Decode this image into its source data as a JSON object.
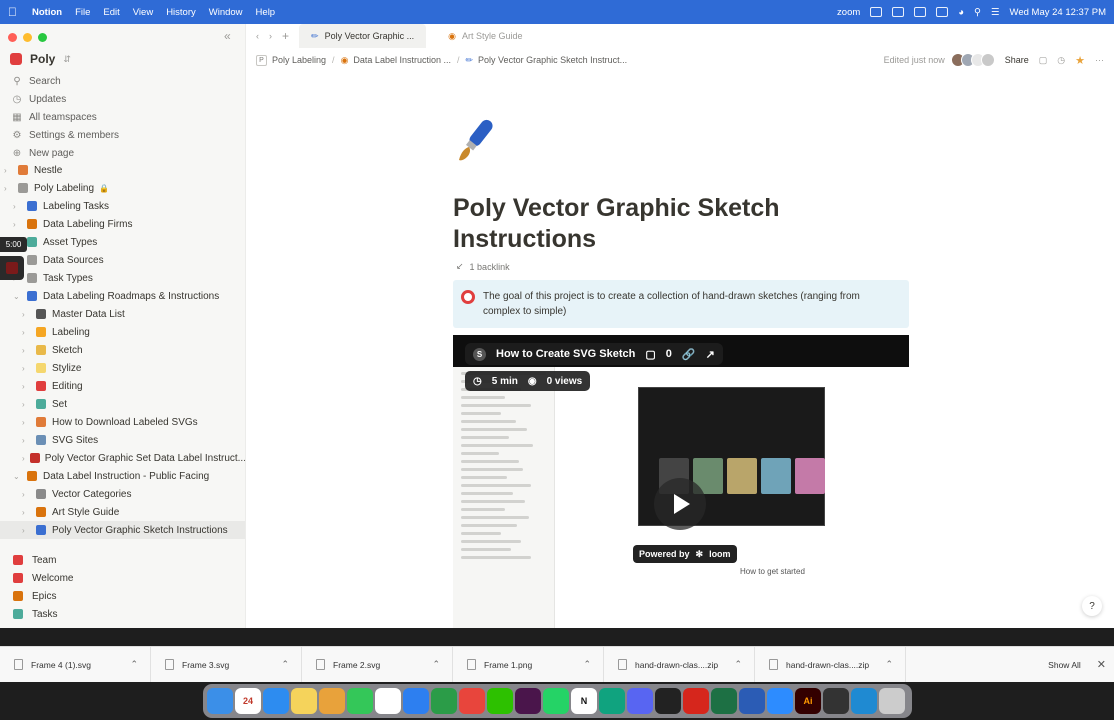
{
  "menubar": {
    "app": "Notion",
    "menus": [
      "File",
      "Edit",
      "View",
      "History",
      "Window",
      "Help"
    ],
    "zoom": "zoom",
    "datetime": "Wed May 24  12:37 PM"
  },
  "sidebar": {
    "workspace": "Poly",
    "nav": [
      {
        "label": "Search",
        "icon": "search-icon"
      },
      {
        "label": "Updates",
        "icon": "clock-icon"
      },
      {
        "label": "All teamspaces",
        "icon": "grid-icon"
      },
      {
        "label": "Settings & members",
        "icon": "gear-icon"
      },
      {
        "label": "New page",
        "icon": "plus-icon"
      }
    ],
    "tree": [
      {
        "label": "Nestle",
        "indent": 0,
        "color": "#e07b39"
      },
      {
        "label": "Poly Labeling",
        "indent": 0,
        "color": "#9b9a97",
        "lock": true
      },
      {
        "label": "Labeling Tasks",
        "indent": 1,
        "color": "#3b6fd1"
      },
      {
        "label": "Data Labeling Firms",
        "indent": 1,
        "color": "#d9730d"
      },
      {
        "label": "Asset Types",
        "indent": 1,
        "color": "#4dab9a"
      },
      {
        "label": "Data Sources",
        "indent": 1,
        "color": "#9b9a97"
      },
      {
        "label": "Task Types",
        "indent": 1,
        "color": "#9b9a97"
      },
      {
        "label": "Data Labeling Roadmaps & Instructions",
        "indent": 1,
        "color": "#3b6fd1",
        "open": true
      },
      {
        "label": "Master Data List",
        "indent": 2,
        "color": "#555"
      },
      {
        "label": "Labeling",
        "indent": 2,
        "color": "#f5a623"
      },
      {
        "label": "Sketch",
        "indent": 2,
        "color": "#e9b949"
      },
      {
        "label": "Stylize",
        "indent": 2,
        "color": "#f5d76e"
      },
      {
        "label": "Editing",
        "indent": 2,
        "color": "#e03e3e"
      },
      {
        "label": "Set",
        "indent": 2,
        "color": "#4dab9a"
      },
      {
        "label": "How to Download Labeled SVGs",
        "indent": 2,
        "color": "#e07b39"
      },
      {
        "label": "SVG Sites",
        "indent": 2,
        "color": "#6b8fb5"
      },
      {
        "label": "Poly Vector Graphic Set Data Label Instruct...",
        "indent": 2,
        "color": "#c4302b"
      },
      {
        "label": "Data Label Instruction - Public Facing",
        "indent": 1,
        "color": "#d9730d",
        "open": true
      },
      {
        "label": "Vector Categories",
        "indent": 2,
        "color": "#8a8a8a"
      },
      {
        "label": "Art Style Guide",
        "indent": 2,
        "color": "#d9730d"
      },
      {
        "label": "Poly Vector Graphic Sketch Instructions",
        "indent": 2,
        "color": "#3b6fd1",
        "active": true
      }
    ],
    "bottom": [
      {
        "label": "Team",
        "color": "#e03e3e"
      },
      {
        "label": "Welcome",
        "color": "#e03e3e"
      },
      {
        "label": "Epics",
        "color": "#d9730d"
      },
      {
        "label": "Tasks",
        "color": "#4dab9a"
      }
    ],
    "timer": "5:00"
  },
  "tabs": [
    {
      "label": "Poly Vector Graphic ...",
      "active": true
    },
    {
      "label": "Art Style Guide",
      "active": false
    }
  ],
  "breadcrumb": {
    "items": [
      "Poly Labeling",
      "Data Label Instruction ...",
      "Poly Vector Graphic Sketch Instruct..."
    ],
    "edited": "Edited just now",
    "share": "Share"
  },
  "page": {
    "title": "Poly Vector Graphic Sketch Instructions",
    "backlinks": "1 backlink",
    "callout": "The goal of this project is to create a collection of hand-drawn sketches (ranging from complex to simple)"
  },
  "video": {
    "title": "How to Create SVG Sketch",
    "comments": "0",
    "duration": "5 min",
    "views": "0 views",
    "powered": "Powered by",
    "brand": "loom",
    "inner_text": "How to get started"
  },
  "downloads": {
    "items": [
      "Frame 4 (1).svg",
      "Frame 3.svg",
      "Frame 2.svg",
      "Frame 1.png",
      "hand-drawn-clas....zip",
      "hand-drawn-clas....zip"
    ],
    "show_all": "Show All"
  },
  "dock": {
    "apps": [
      {
        "name": "finder",
        "color": "#3b8fe8"
      },
      {
        "name": "calendar",
        "color": "#ffffff",
        "text": "24"
      },
      {
        "name": "app-store",
        "color": "#2d8cf0"
      },
      {
        "name": "notes",
        "color": "#f5d35b"
      },
      {
        "name": "photos",
        "color": "#e8a23b"
      },
      {
        "name": "messages",
        "color": "#34c759"
      },
      {
        "name": "reminders",
        "color": "#ffffff"
      },
      {
        "name": "keynote",
        "color": "#2d7ff0"
      },
      {
        "name": "numbers",
        "color": "#2b9c48"
      },
      {
        "name": "chrome",
        "color": "#e8453c"
      },
      {
        "name": "wechat",
        "color": "#2dc100"
      },
      {
        "name": "slack",
        "color": "#4a154b"
      },
      {
        "name": "whatsapp",
        "color": "#25d366"
      },
      {
        "name": "notion",
        "color": "#ffffff",
        "text": "N"
      },
      {
        "name": "chatgpt",
        "color": "#10a37f"
      },
      {
        "name": "discord",
        "color": "#5865f2"
      },
      {
        "name": "terminal",
        "color": "#222222"
      },
      {
        "name": "acrobat",
        "color": "#d6261c"
      },
      {
        "name": "excel",
        "color": "#1d7044"
      },
      {
        "name": "word",
        "color": "#2b5cb5"
      },
      {
        "name": "zoom",
        "color": "#2d8cff"
      },
      {
        "name": "illustrator",
        "color": "#330000",
        "text": "Ai"
      },
      {
        "name": "github",
        "color": "#333333"
      },
      {
        "name": "vscode",
        "color": "#1f8ad2"
      },
      {
        "name": "trash",
        "color": "#cccccc"
      }
    ]
  }
}
